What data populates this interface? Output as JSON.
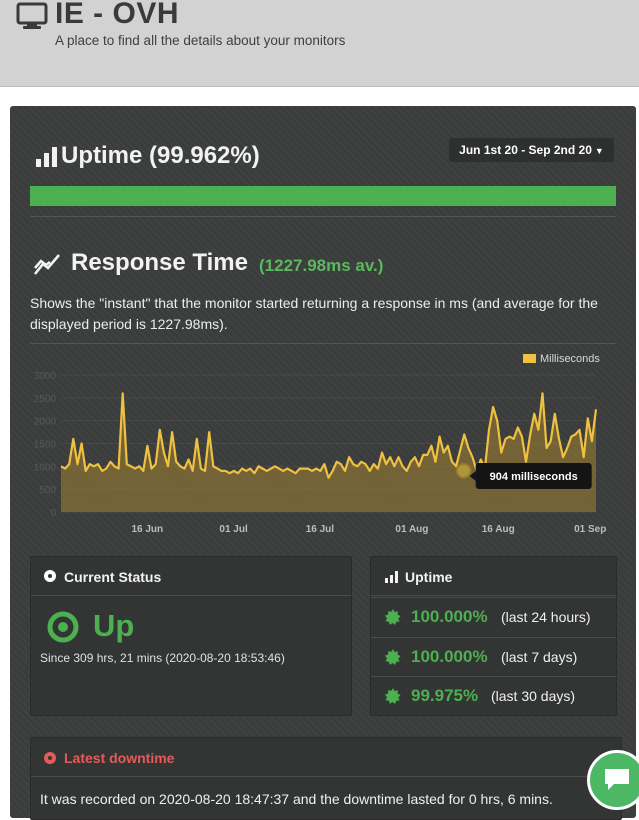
{
  "header": {
    "title": "IE - OVH",
    "subtitle": "A place to find all the details about your monitors",
    "icon": "monitor-icon"
  },
  "uptime": {
    "title": "Uptime (99.962%)",
    "date_range": "Jun 1st 20 - Sep 2nd 20",
    "bar_color": "#4caf50"
  },
  "response": {
    "title": "Response Time",
    "average": "(1227.98ms av.)",
    "description": "Shows the \"instant\" that the monitor started returning a response in ms (and average for the displayed period is 1227.98ms)."
  },
  "chart_data": {
    "type": "area",
    "title": "",
    "xlabel": "",
    "ylabel": "",
    "legend": "Milliseconds",
    "legend_position": "top-right",
    "ylim": [
      0,
      3000
    ],
    "yticks": [
      "3000",
      "2500",
      "2000",
      "1500",
      "1000",
      "500",
      "0"
    ],
    "xticks": [
      {
        "label": "16 Jun",
        "day": 15
      },
      {
        "label": "01 Jul",
        "day": 30
      },
      {
        "label": "16 Jul",
        "day": 45
      },
      {
        "label": "01 Aug",
        "day": 61
      },
      {
        "label": "16 Aug",
        "day": 76
      },
      {
        "label": "01 Sep",
        "day": 92
      }
    ],
    "color": "#f0c040",
    "tooltip": {
      "text": "904 milliseconds",
      "day": 70,
      "value": 904
    },
    "series": [
      {
        "name": "Milliseconds",
        "values": [
          1000,
          950,
          1050,
          1600,
          1050,
          1500,
          900,
          1050,
          1000,
          1050,
          900,
          950,
          1100,
          1000,
          950,
          2600,
          1050,
          1000,
          950,
          1000,
          900,
          1450,
          950,
          1050,
          1800,
          1300,
          1000,
          1750,
          1100,
          1000,
          950,
          1150,
          900,
          1600,
          950,
          900,
          1750,
          1000,
          950,
          900,
          900,
          850,
          900,
          850,
          950,
          900,
          950,
          850,
          1000,
          950,
          900,
          950,
          1000,
          950,
          900,
          950,
          900,
          850,
          950,
          950,
          950,
          900,
          950,
          900,
          1050,
          750,
          900,
          1100,
          1050,
          900,
          1200,
          1050,
          1000,
          1100,
          1050,
          900,
          1050,
          950,
          1300,
          1050,
          1200,
          1000,
          1200,
          1000,
          900,
          1100,
          1200,
          1000,
          1250,
          1250,
          1450,
          1100,
          1650,
          1300,
          1450,
          1100,
          1000,
          1350,
          1700,
          1400,
          1200,
          900,
          1150,
          950,
          1800,
          2300,
          2000,
          1300,
          1600,
          1650,
          1600,
          1850,
          1650,
          1100,
          1700,
          2150,
          1800,
          2600,
          1400,
          1550,
          2150,
          1600,
          1200,
          1400,
          1650,
          1700,
          1800,
          1200,
          2050,
          1550,
          2250
        ]
      }
    ]
  },
  "status": {
    "header": "Current Status",
    "state": "Up",
    "since": "Since 309 hrs, 21 mins (2020-08-20 18:53:46)"
  },
  "uptime_card": {
    "header": "Uptime",
    "rows": [
      {
        "pct": "100.000%",
        "period": "(last 24 hours)"
      },
      {
        "pct": "100.000%",
        "period": "(last 7 days)"
      },
      {
        "pct": "99.975%",
        "period": "(last 30 days)"
      }
    ]
  },
  "downtime": {
    "header": "Latest downtime",
    "text": "It was recorded on 2020-08-20 18:47:37 and the downtime lasted for 0 hrs, 6 mins."
  },
  "colors": {
    "accent_green": "#4caf50",
    "alert_red": "#e45b5b",
    "panel_bg": "#3a3d3c",
    "chart_line": "#f0c040"
  }
}
